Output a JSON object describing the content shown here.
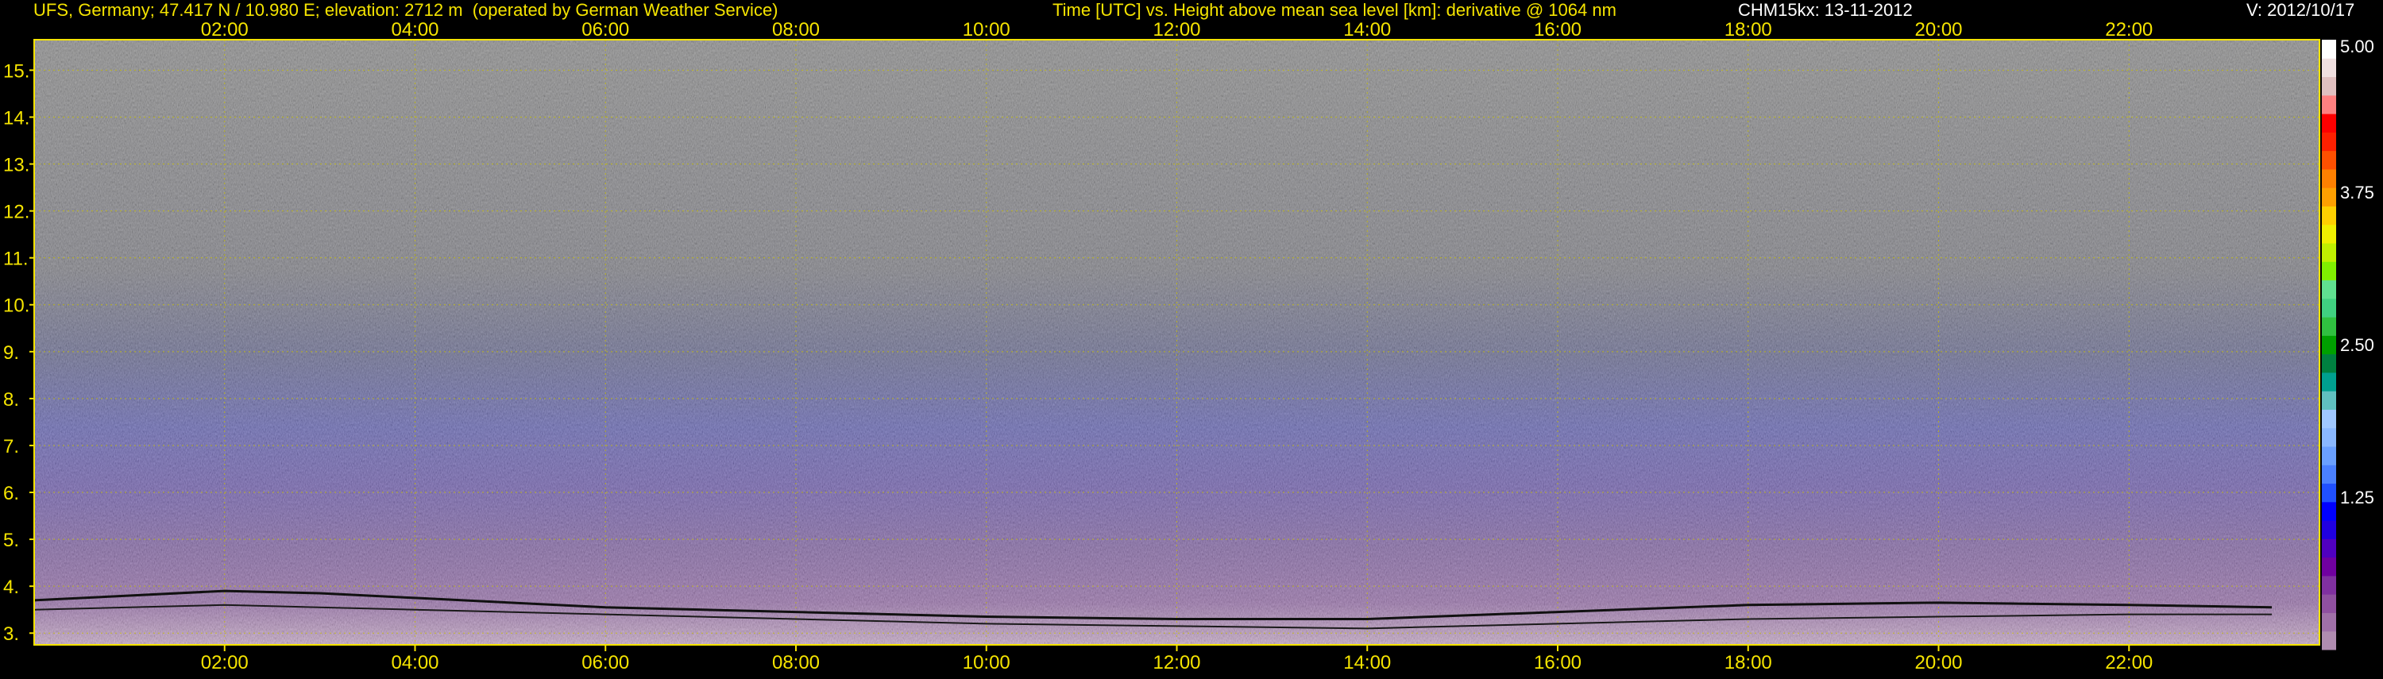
{
  "header": {
    "station": "UFS, Germany; 47.417 N / 10.980 E; elevation: 2712 m  (operated by German Weather Service)",
    "title": "Time [UTC] vs. Height above mean sea level [km]: derivative @ 1064 nm",
    "instrument": "CHM15kx: 13-11-2012",
    "version": "V: 2012/10/17"
  },
  "chart_data": {
    "type": "heatmap",
    "title": "Time [UTC] vs. Height above mean sea level [km]: derivative @ 1064 nm",
    "x_ticks": [
      "02:00",
      "04:00",
      "06:00",
      "08:00",
      "10:00",
      "12:00",
      "14:00",
      "16:00",
      "18:00",
      "20:00",
      "22:00"
    ],
    "x_tick_hours": [
      2,
      4,
      6,
      8,
      10,
      12,
      14,
      16,
      18,
      20,
      22
    ],
    "xlim_hours": [
      0,
      24
    ],
    "y_ticks": [
      "3.",
      "4.",
      "5.",
      "6.",
      "7.",
      "8.",
      "9.",
      "10.",
      "11.",
      "12.",
      "13.",
      "14.",
      "15."
    ],
    "y_tick_values": [
      3,
      4,
      5,
      6,
      7,
      8,
      9,
      10,
      11,
      12,
      13,
      14,
      15
    ],
    "ylim_km": [
      2.75,
      15.65
    ],
    "grid": true,
    "colorbar": {
      "labels": [
        "5.00",
        "3.75",
        "2.50",
        "1.25"
      ],
      "label_values": [
        5.0,
        3.75,
        2.5,
        1.25
      ],
      "range": [
        0,
        5.0
      ],
      "colors": [
        "#b08cb0",
        "#a070a8",
        "#9050a0",
        "#8030a0",
        "#7000a0",
        "#5000c0",
        "#2000e0",
        "#0000ff",
        "#2050ff",
        "#4a80ff",
        "#6aa0ff",
        "#8ab8ff",
        "#a0c8ff",
        "#60c0c0",
        "#00a090",
        "#008040",
        "#00a000",
        "#30c040",
        "#40d080",
        "#60e090",
        "#80f000",
        "#c0f000",
        "#f0f000",
        "#ffd000",
        "#ffa000",
        "#ff8000",
        "#ff5000",
        "#ff2000",
        "#ff0000",
        "#ff8080",
        "#e0c0c0",
        "#f0e0e0",
        "#ffffff"
      ]
    },
    "cloud_top_line_km": {
      "hours": [
        0,
        1,
        2,
        3,
        4,
        5,
        6,
        8,
        10,
        12,
        14,
        16,
        18,
        20,
        22,
        23.5
      ],
      "values": [
        3.7,
        3.8,
        3.9,
        3.85,
        3.75,
        3.65,
        3.55,
        3.45,
        3.35,
        3.3,
        3.3,
        3.45,
        3.6,
        3.65,
        3.6,
        3.55
      ]
    },
    "boundary_line_km": {
      "hours": [
        0,
        2,
        4,
        6,
        8,
        10,
        12,
        14,
        16,
        18,
        20,
        22,
        23.5
      ],
      "values": [
        3.5,
        3.6,
        3.5,
        3.4,
        3.3,
        3.2,
        3.15,
        3.1,
        3.2,
        3.3,
        3.35,
        3.4,
        3.4
      ]
    },
    "feature_label": ""
  }
}
